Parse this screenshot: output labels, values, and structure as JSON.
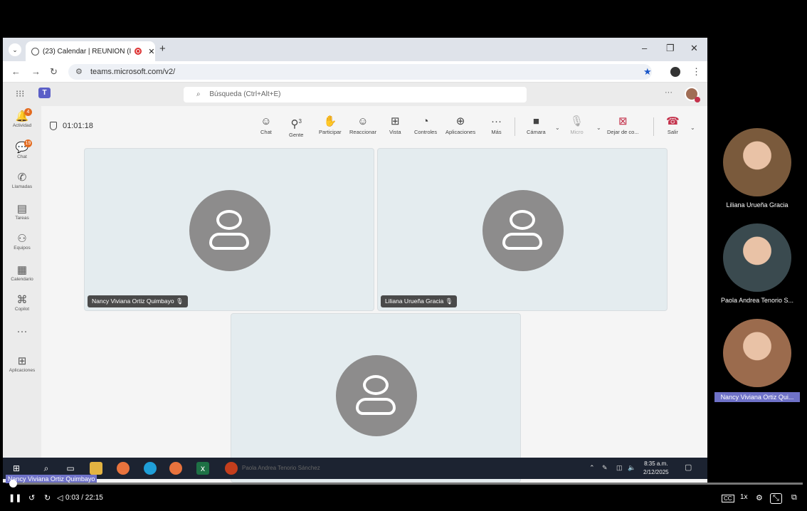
{
  "browser": {
    "tab_title": "(23) Calendar | REUNION (I",
    "new_tab": "+",
    "url": "teams.microsoft.com/v2/",
    "window_controls": [
      "–",
      "❐",
      "✕"
    ]
  },
  "teams": {
    "search_placeholder": "Búsqueda (Ctrl+Alt+E)",
    "more": "···"
  },
  "rail": [
    {
      "label": "Actividad",
      "icon": "bell-icon",
      "glyph": "🔔",
      "badge": "4"
    },
    {
      "label": "Chat",
      "icon": "chat-icon",
      "glyph": "💬",
      "badge": "19"
    },
    {
      "label": "Llamadas",
      "icon": "phone-icon",
      "glyph": "✆",
      "badge": ""
    },
    {
      "label": "Tareas",
      "icon": "tasks-icon",
      "glyph": "▤",
      "badge": ""
    },
    {
      "label": "Equipos",
      "icon": "teams-icon",
      "glyph": "⚇",
      "badge": ""
    },
    {
      "label": "Calendario",
      "icon": "calendar-icon",
      "glyph": "▦",
      "badge": ""
    },
    {
      "label": "Copilot",
      "icon": "copilot-icon",
      "glyph": "⌘",
      "badge": ""
    },
    {
      "label": "",
      "icon": "more-icon",
      "glyph": "···",
      "badge": ""
    },
    {
      "label": "Aplicaciones",
      "icon": "apps-icon",
      "glyph": "⊞",
      "badge": ""
    }
  ],
  "toolbar": {
    "timer": "01:01:18",
    "chat": "Chat",
    "people": "Gente",
    "people_count": "3",
    "raise": "Participar",
    "react": "Reaccionar",
    "view": "Vista",
    "controls": "Controles",
    "apps": "Aplicaciones",
    "more": "Más",
    "camera": "Cámara",
    "mic": "Micro",
    "share": "Dejar de co...",
    "leave": "Salir"
  },
  "tiles": [
    {
      "name": "Nancy Viviana Ortiz Quimbayo"
    },
    {
      "name": "Liliana Urueña Gracia"
    },
    {
      "name": ""
    }
  ],
  "taskbar": {
    "time": "8:35 a.m.",
    "date": "2/12/2025",
    "ghost_label": "Paola Andrea Tenorio Sánchez"
  },
  "right_panel": [
    {
      "name": "Liliana Urueña Gracia",
      "color": "#7a5a3c"
    },
    {
      "name": "Paola Andrea Tenorio S...",
      "color": "#3a4a4f"
    },
    {
      "name": "Nancy Viviana Ortiz Qui...",
      "color": "#9b6b4d"
    }
  ],
  "player": {
    "caption": "Nancy Viviana Ortiz Quimbayo",
    "time": "0:03 / 22:15",
    "speed": "1x",
    "cc": "CC",
    "progress": 0.002
  }
}
